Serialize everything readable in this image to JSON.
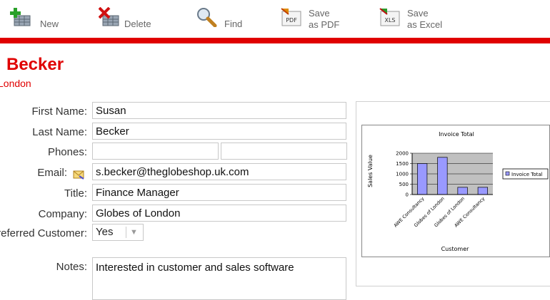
{
  "toolbar": {
    "new_label": "New",
    "delete_label": "Delete",
    "find_label": "Find",
    "save_pdf_line1": "Save",
    "save_pdf_line2": "as PDF",
    "save_excel_line1": "Save",
    "save_excel_line2": "as Excel",
    "pdf_icon_text": "PDF",
    "xls_icon_text": "XLS"
  },
  "colors": {
    "accent": "#e00000",
    "chart_plot_bg": "#c0c0c0",
    "bar_fill": "#9999ff"
  },
  "contact": {
    "name": "Becker",
    "city": "London"
  },
  "form": {
    "first_name_label": "First Name:",
    "first_name": "Susan",
    "last_name_label": "Last Name:",
    "last_name": "Becker",
    "phones_label": "Phones:",
    "phone1": "",
    "phone2": "",
    "email_label": "Email:",
    "email": "s.becker@theglobeshop.uk.com",
    "title_label": "Title:",
    "title": "Finance Manager",
    "company_label": "Company:",
    "company": "Globes of London",
    "preferred_label": "Preferred Customer:",
    "preferred_value": "Yes",
    "notes_label": "Notes:",
    "notes": "Interested in customer and sales software"
  },
  "chart_data": {
    "type": "bar",
    "title": "Invoice Total",
    "xlabel": "Customer",
    "ylabel": "Sales Value",
    "ylim": [
      0,
      2000
    ],
    "yticks": [
      0,
      500,
      1000,
      1500,
      2000
    ],
    "categories": [
      "AWE Consultancy",
      "Globes of London",
      "Globes of London",
      "AWE Consultancy"
    ],
    "series": [
      {
        "name": "Invoice Total",
        "values": [
          1500,
          1800,
          350,
          350
        ]
      }
    ],
    "legend": "right",
    "grid": true
  }
}
